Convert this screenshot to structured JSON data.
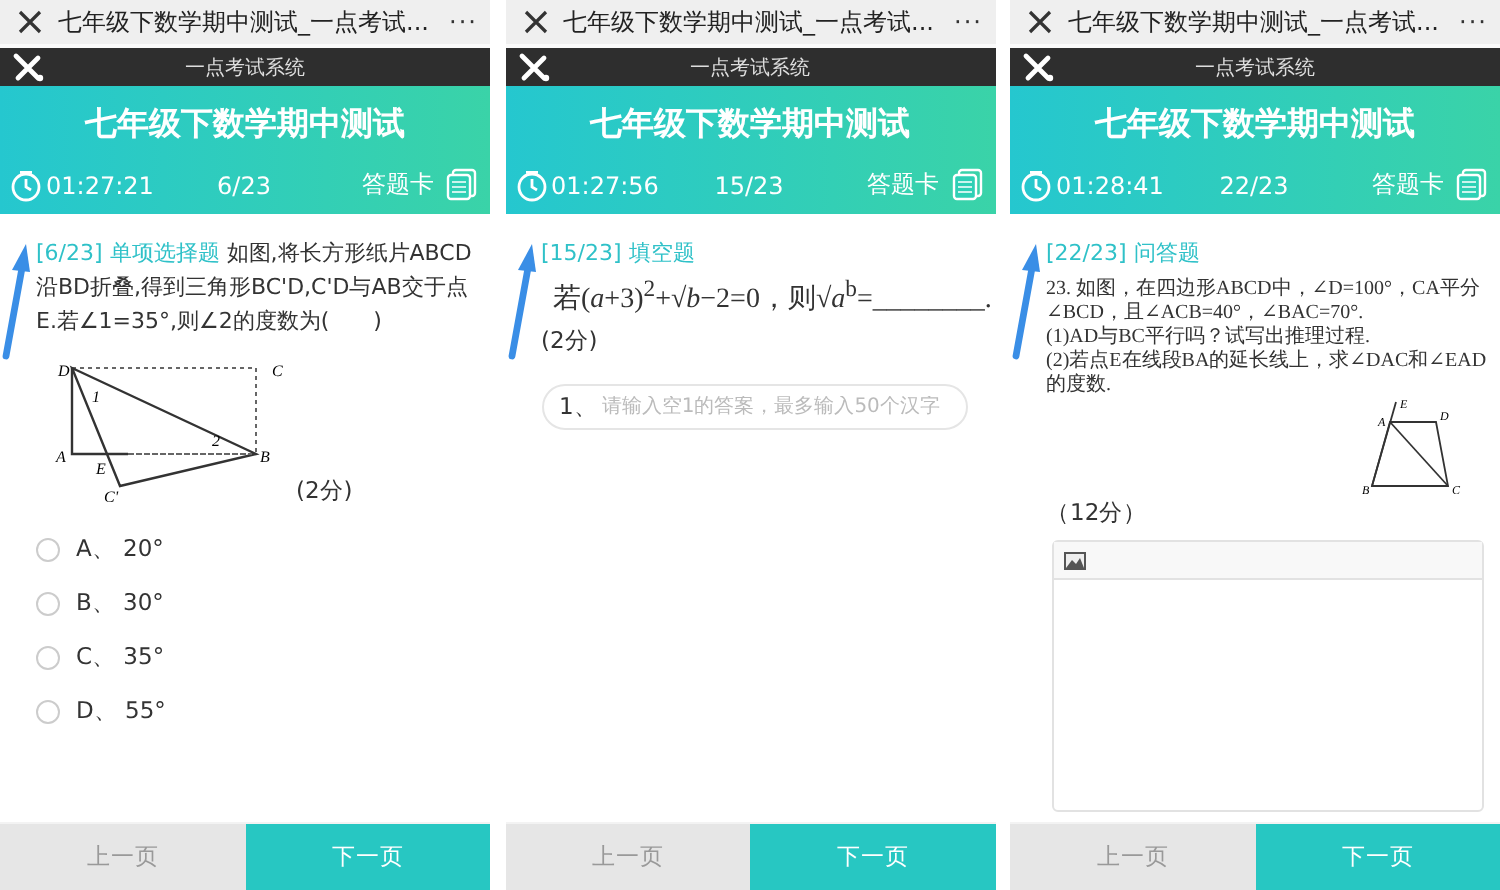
{
  "panels": [
    {
      "browser_title": "七年级下数学期中测试_一点考试...",
      "more": "···",
      "app_name": "一点考试系统",
      "heading": "七年级下数学期中测试",
      "timer": "01:27:21",
      "progress": "6/23",
      "card_label": "答题卡",
      "question": {
        "kind": "choice",
        "number": "[6/23]",
        "type": "单项选择题",
        "text": "如图,将长方形纸片ABCD沿BD折叠,得到三角形BC'D,C'D与AB交于点E.若∠1=35°,则∠2的度数为(　　)",
        "figure_labels": [
          "D",
          "C",
          "A",
          "E",
          "B",
          "C'",
          "1",
          "2"
        ],
        "score": "(2分)",
        "options": [
          {
            "text": "A、 20°",
            "selected": false
          },
          {
            "text": "B、 30°",
            "selected": false
          },
          {
            "text": "C、 35°",
            "selected": false
          },
          {
            "text": "D、 55°",
            "selected": false
          }
        ]
      },
      "prev_label": "上一页",
      "next_label": "下一页"
    },
    {
      "browser_title": "七年级下数学期中测试_一点考试...",
      "more": "···",
      "app_name": "一点考试系统",
      "heading": "七年级下数学期中测试",
      "timer": "01:27:56",
      "progress": "15/23",
      "card_label": "答题卡",
      "question": {
        "kind": "fill",
        "number": "[15/23]",
        "type": "填空题",
        "text": "若(*a*+3)$^{2}$+√*b*−2=0，则√*a*$^{b}$=________.",
        "score": "(2分)",
        "blank_prefix": "1、",
        "placeholder": "请输入空1的答案，最多输入50个汉字"
      },
      "prev_label": "上一页",
      "next_label": "下一页"
    },
    {
      "browser_title": "七年级下数学期中测试_一点考试...",
      "more": "···",
      "app_name": "一点考试系统",
      "heading": "七年级下数学期中测试",
      "timer": "01:28:41",
      "progress": "22/23",
      "card_label": "答题卡",
      "question": {
        "kind": "essay",
        "number": "[22/23]",
        "type": "问答题",
        "lines": [
          "23. 如图，在四边形ABCD中，∠D=100°，CA平分∠BCD，且∠ACB=40°，∠BAC=70°.",
          "(1)AD与BC平行吗？试写出推理过程.",
          "(2)若点E在线段BA的延长线上，求∠DAC和∠EAD的度数."
        ],
        "figure_labels": [
          "E",
          "A",
          "D",
          "B",
          "C"
        ],
        "score": "（12分）"
      },
      "prev_label": "上一页",
      "next_label": "下一页"
    }
  ]
}
